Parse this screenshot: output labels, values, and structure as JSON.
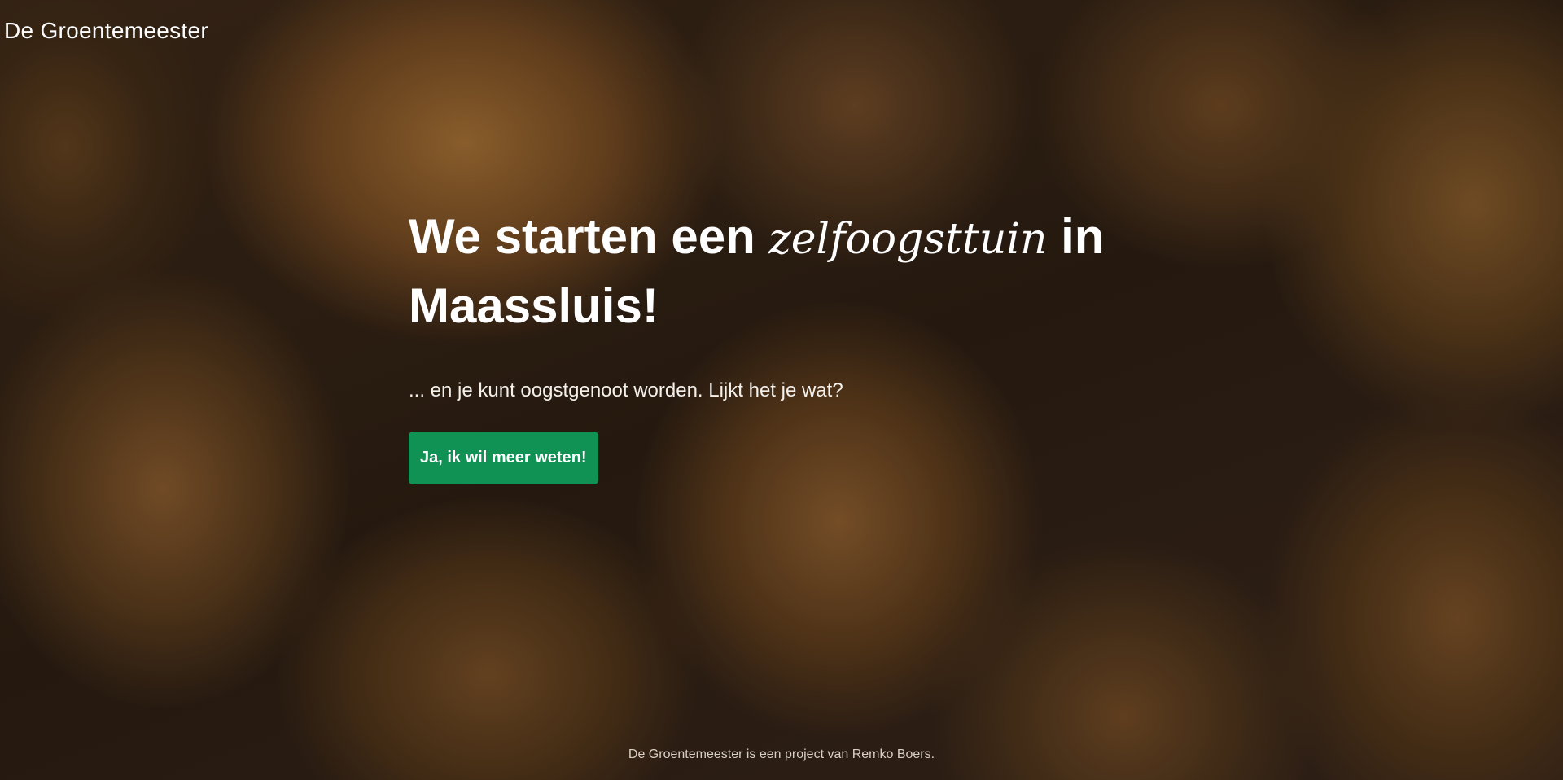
{
  "header": {
    "brand": "De Groentemeester"
  },
  "hero": {
    "headline_start": "We starten een ",
    "headline_accent": "zelfoogsttuin",
    "headline_end": " in Maassluis!",
    "subtitle": "... en je kunt oogstgenoot worden. Lijkt het je wat?",
    "cta_label": "Ja, ik wil meer weten!"
  },
  "footer": {
    "text": "De Groentemeester is een project van Remko Boers."
  },
  "colors": {
    "cta_background": "#0f9254",
    "text": "#ffffff"
  }
}
